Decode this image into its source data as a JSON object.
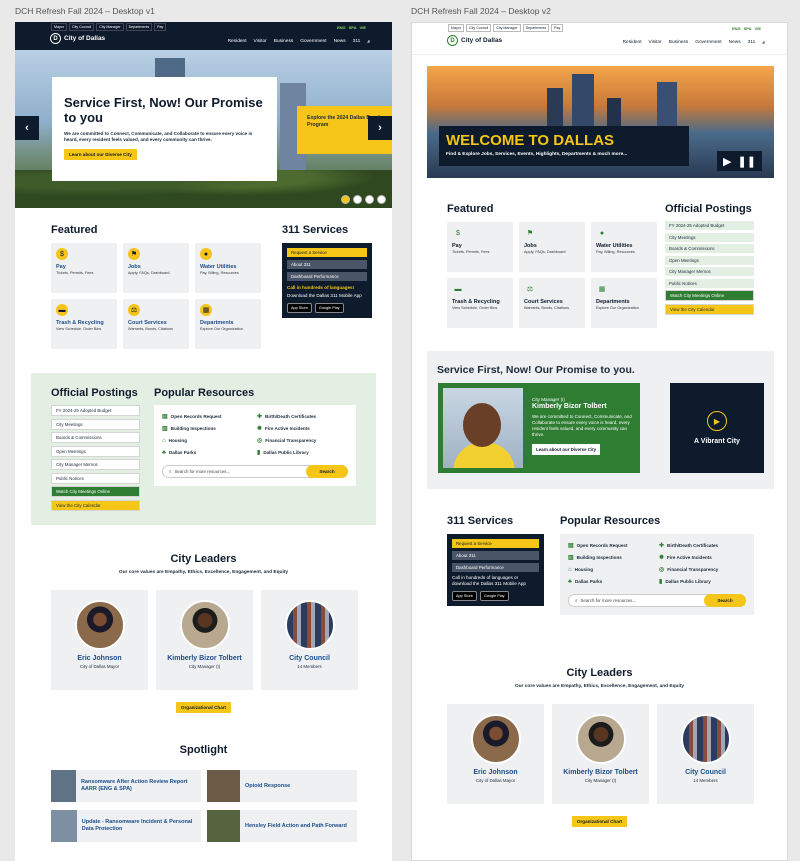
{
  "canvas": {
    "v1_label": "DCH Refresh Fall 2024 – Desktop v1",
    "v2_label": "DCH Refresh Fall 2024 – Desktop v2"
  },
  "header": {
    "util_links": [
      "Mayor",
      "City Council",
      "City Manager",
      "Departments",
      "Pay"
    ],
    "langs": [
      "ENG",
      "SPA",
      "VIE"
    ],
    "logo_text": "City of Dallas",
    "nav": [
      "Resident",
      "Visitor",
      "Business",
      "Government",
      "News",
      "311"
    ]
  },
  "hero_v1": {
    "title": "Service First, Now! Our Promise to you",
    "body": "We are committed to Connect, Communicate, and Collaborate to ensure every voice is heard, every resident feels valued, and every community can thrive.",
    "button": "Learn about our Diverse City",
    "promo": "Explore the 2024 Dallas Bond Program"
  },
  "featured": {
    "title": "Featured",
    "tiles": [
      {
        "title": "Pay",
        "sub": "Tickets, Permits, Fees",
        "icon": "dollar-icon"
      },
      {
        "title": "Jobs",
        "sub": "Apply, FAQs, Dashboard",
        "icon": "signpost-icon"
      },
      {
        "title": "Water Utilities",
        "sub": "Pay, Billing, Resources",
        "icon": "water-drop-icon"
      },
      {
        "title": "Trash & Recycling",
        "sub": "View Schedule, Order Bins",
        "icon": "truck-icon"
      },
      {
        "title": "Court Services",
        "sub": "Warrants, Bonds, Citations",
        "icon": "scales-icon"
      },
      {
        "title": "Departments",
        "sub": "Explore Our Organization",
        "icon": "org-chart-icon"
      }
    ]
  },
  "services311": {
    "title": "311 Services",
    "buttons": [
      "Request a Service",
      "About 311",
      "Dashboard Performance"
    ],
    "v1_call": "Call in hundreds of languages!",
    "v1_download": "Download the Dallas 311 Mobile App",
    "v2_text": "Call in hundreds of languages or download the Dallas 311 Mobile App",
    "stores": [
      "App Store",
      "Google Play"
    ]
  },
  "postings": {
    "title": "Official Postings",
    "items": [
      "FY 2024-25 Adopted Budget",
      "City Meetings",
      "Boards & Commissions",
      "Open Meetings",
      "City Manager Memos",
      "Public Notices"
    ],
    "green_item": "Watch City Meetings Online",
    "yellow_item": "View the City Calendar"
  },
  "resources": {
    "title": "Popular Resources",
    "items": [
      "Open Records Request",
      "Birth/Death Certificates",
      "Building Inspections",
      "Fire Active Incidents",
      "Housing",
      "Financial Transparency",
      "Dallas Parks",
      "Dallas Public Library"
    ],
    "search_placeholder": "Search for more resources...",
    "search_button": "Search"
  },
  "leaders": {
    "title": "City Leaders",
    "subtitle": "Our core values are Empathy, Ethics, Excellence, Engagement, and Equity",
    "cards": [
      {
        "name": "Eric Johnson",
        "role": "City of Dallas Mayor"
      },
      {
        "name": "Kimberly Bizor Tolbert",
        "role": "City Manager (I)"
      },
      {
        "name": "City Council",
        "role": "14 Members"
      }
    ],
    "button": "Organizational Chart"
  },
  "spotlight": {
    "title": "Spotlight",
    "items": [
      "Ransomware After Action Review Report AARR (ENG & SPA)",
      "Opioid Response",
      "Update - Ransomware Incident & Personal Data Protection",
      "Hensley Field Action and Path Forward"
    ]
  },
  "hero_v2": {
    "title": "WELCOME TO DALLAS",
    "subtitle": "Find & Explore Jobs, Services, Events, Highlights, Departments & much more..."
  },
  "promise_v2": {
    "title": "Service First, Now! Our Promise to you.",
    "role": "City Manager (I)",
    "name": "Kimberly Bizor Tolbert",
    "body": "We are committed to Connect, Communicate, and Collaborate to ensure every voice is heard, every resident feels valued, and every community can thrive.",
    "button": "Learn about our Diverse City",
    "video_label": "A Vibrant City"
  }
}
